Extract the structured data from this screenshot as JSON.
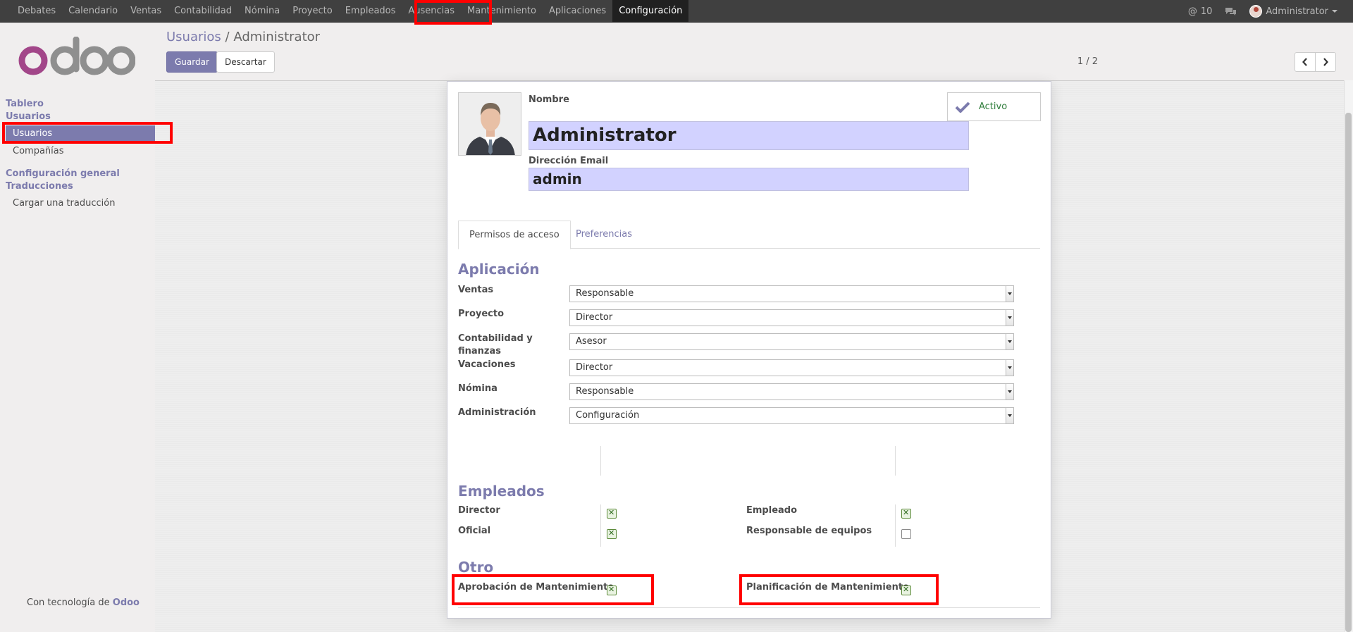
{
  "topbar": {
    "menu": [
      "Debates",
      "Calendario",
      "Ventas",
      "Contabilidad",
      "Nómina",
      "Proyecto",
      "Empleados",
      "Ausencias",
      "Mantenimiento",
      "Aplicaciones",
      "Configuración"
    ],
    "active_menu": "Configuración",
    "mentions_count": "10",
    "user": "Administrator"
  },
  "sidebar": {
    "logo": "odoo",
    "sections": [
      {
        "title": "Tablero"
      },
      {
        "title": "Usuarios",
        "items": [
          "Usuarios",
          "Compañías"
        ]
      },
      {
        "title": "Configuración general"
      },
      {
        "title": "Traducciones",
        "items": [
          "Cargar una traducción"
        ]
      }
    ],
    "powered_prefix": "Con tecnología de",
    "powered_brand": "Odoo"
  },
  "control": {
    "breadcrumb_parent": "Usuarios",
    "breadcrumb_sep": "/",
    "breadcrumb_current": "Administrator",
    "save_label": "Guardar",
    "discard_label": "Descartar",
    "pager": "1 / 2"
  },
  "form": {
    "name_label": "Nombre",
    "name_value": "Administrator",
    "email_label": "Dirección Email",
    "email_value": "admin",
    "active_label": "Activo",
    "tabs": [
      "Permisos de acceso",
      "Preferencias"
    ],
    "application_title": "Aplicación",
    "applications": [
      {
        "label": "Ventas",
        "value": "Responsable"
      },
      {
        "label": "Proyecto",
        "value": "Director"
      },
      {
        "label": "Contabilidad y finanzas",
        "value": "Asesor"
      },
      {
        "label": "Vacaciones",
        "value": "Director"
      },
      {
        "label": "Nómina",
        "value": "Responsable"
      },
      {
        "label": "Administración",
        "value": "Configuración"
      }
    ],
    "employees_title": "Empleados",
    "employees": [
      {
        "label": "Director",
        "checked": true
      },
      {
        "label": "Empleado",
        "checked": true
      },
      {
        "label": "Oficial",
        "checked": true
      },
      {
        "label": "Responsable de equipos",
        "checked": false
      }
    ],
    "other_title": "Otro",
    "other": [
      {
        "label": "Aprobación de Mantenimiento",
        "checked": true
      },
      {
        "label": "Planificación de Mantenimiento",
        "checked": true
      }
    ]
  },
  "colors": {
    "accent": "#7c7bad",
    "highlight": "#ff0000",
    "topbar": "#404040",
    "field_bg": "#d2d2ff"
  }
}
